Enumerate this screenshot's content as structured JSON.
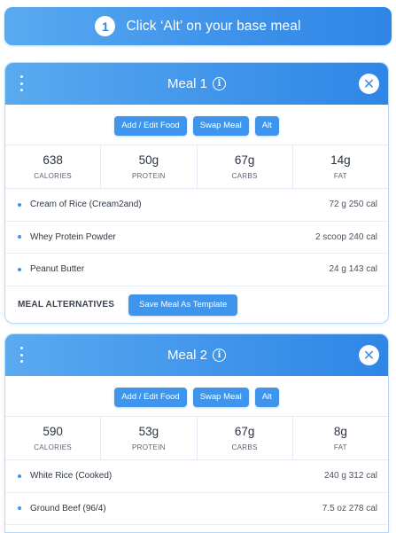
{
  "banner": {
    "step": "1",
    "text": "Click ‘Alt’ on your base meal"
  },
  "actions": {
    "add_edit": "Add / Edit Food",
    "swap": "Swap Meal",
    "alt": "Alt"
  },
  "stat_labels": {
    "calories": "CALORIES",
    "protein": "PROTEIN",
    "carbs": "CARBS",
    "fat": "FAT"
  },
  "meals": [
    {
      "title": "Meal 1",
      "stats": {
        "calories": "638",
        "protein": "50g",
        "carbs": "67g",
        "fat": "14g"
      },
      "foods": [
        {
          "name": "Cream of Rice (Cream2and)",
          "amount": "72 g 250 cal"
        },
        {
          "name": "Whey Protein Powder",
          "amount": "2 scoop 240 cal"
        },
        {
          "name": "Peanut Butter",
          "amount": "24 g 143 cal"
        }
      ],
      "alternatives_label": "MEAL ALTERNATIVES",
      "template_button": "Save Meal As Template"
    },
    {
      "title": "Meal 2",
      "stats": {
        "calories": "590",
        "protein": "53g",
        "carbs": "67g",
        "fat": "8g"
      },
      "foods": [
        {
          "name": "White Rice (Cooked)",
          "amount": "240 g 312 cal"
        },
        {
          "name": "Ground Beef (96/4)",
          "amount": "7.5 oz 278 cal"
        }
      ]
    }
  ],
  "icons": {
    "menu": "kebab-menu-icon",
    "info": "info-icon",
    "close": "close-icon"
  },
  "colors": {
    "accent": "#3f95ec",
    "header_gradient_start": "#5aaaf0",
    "header_gradient_end": "#2f86e6"
  }
}
